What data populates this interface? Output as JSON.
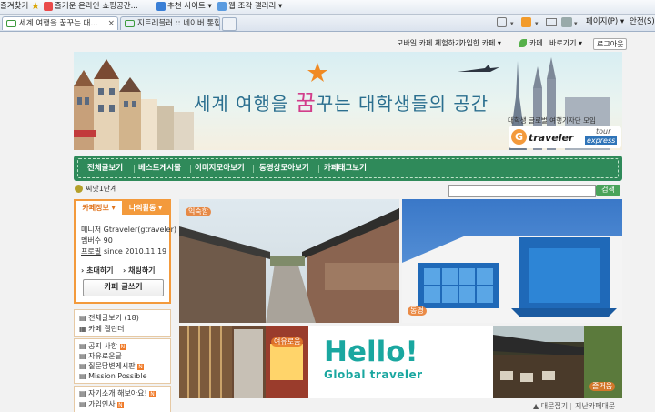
{
  "browser": {
    "favorites_bar": {
      "favorites_label": "즐겨찾기",
      "items": [
        "즐거운 온라인 쇼핑공간...",
        "추천 사이트 ▾",
        "웹 조각 갤러리 ▾"
      ]
    },
    "tabs": [
      {
        "title": "세계 여행을 꿈꾸는 대...",
        "active": true
      },
      {
        "title": "지트레블러 :: 네이버 통합...",
        "active": false
      }
    ],
    "command_bar": {
      "page_menu": "페이지(P) ▾",
      "safety_menu": "안전(S) ▾"
    }
  },
  "top_links": {
    "mobile": "모바일 카페 체험하기",
    "joined": "가입한 카페 ▾",
    "cafe": "카페",
    "shortcut": "바로가기 ▾",
    "logout": "로그아웃"
  },
  "banner": {
    "headline_part1": "세계 여행을 ",
    "headline_accent": "꿈",
    "headline_part2": "꾸는 대학생들의 공간",
    "subtitle": "대학생 글로벌 여행기자단 모임",
    "logo_main": "traveler",
    "logo_sub_top": "tour",
    "logo_sub_bottom": "express",
    "accent_color": "#d23d8a"
  },
  "menu": {
    "items": [
      "전체글보기",
      "베스트게시물",
      "이미지모아보기",
      "동영상모아보기",
      "카페태그보기"
    ]
  },
  "level_label": "씨앗1단계",
  "search": {
    "button": "검색"
  },
  "sidebar": {
    "tab_info": "카페정보 ▾",
    "tab_activity": "나의활동 ▾",
    "manager": "매니저 Gtraveler(gtraveler)",
    "members": "멤버수 90",
    "profile_label": "프로필",
    "since": "since 2010.11.19",
    "invite": "초대하기",
    "ranking": "채팅하기",
    "write_button": "카페 글쓰기",
    "menu1": [
      {
        "label": "전체글보기",
        "count": "(18)"
      },
      {
        "label": "카페 캘린더",
        "count": ""
      }
    ],
    "menu2": [
      {
        "label": "공지 사항",
        "new": true
      },
      {
        "label": "자유로운글",
        "new": false
      },
      {
        "label": "질문답변게시판",
        "new": true
      },
      {
        "label": "Mission Possible",
        "new": false
      }
    ],
    "menu3": [
      {
        "label": "자기소개 해보아요!",
        "new": true
      },
      {
        "label": "가입인사",
        "new": true
      }
    ]
  },
  "photos": {
    "label1": "익숙함",
    "label2": "동경",
    "label3": "여유로움",
    "label4": "즐거움",
    "hello": "Hello!",
    "hello_sub": "Global traveler",
    "hello_color": "#1aa7a0"
  },
  "bottom_links": {
    "link1": "대문접기",
    "link2": "지난카페대문"
  }
}
